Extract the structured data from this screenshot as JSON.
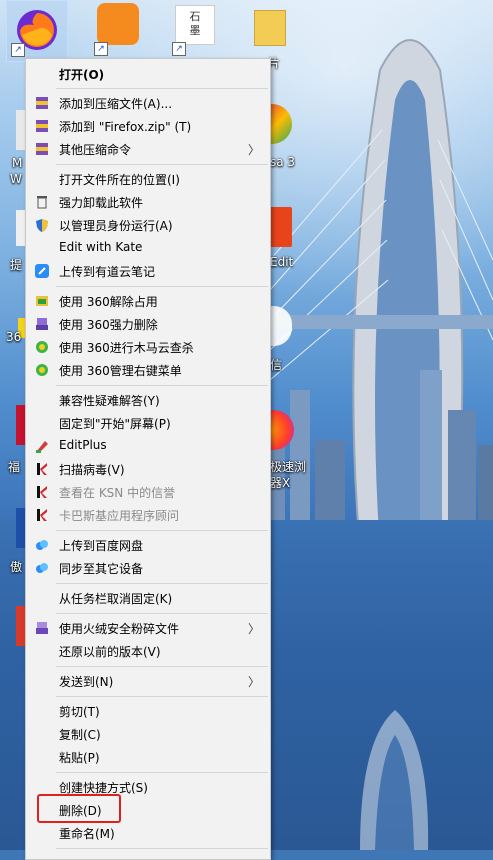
{
  "desktop": {
    "icons": [
      {
        "name": "Firefox",
        "label": ""
      },
      {
        "name": "UC Browser",
        "label": ""
      },
      {
        "name": "石墨",
        "label": "石\n墨"
      },
      {
        "name": "folder",
        "label": "片"
      }
    ],
    "edge_labels": {
      "left_m": "M",
      "left_w": "W",
      "left_ti": "提",
      "left_36": "36",
      "left_fu": "福",
      "left_ao": "傲",
      "right_sa3": "sa 3",
      "right_edit": "Edit",
      "right_xin": "信",
      "right_jisu1": "极速浏",
      "right_jisu2": "器X"
    }
  },
  "context_menu": {
    "items": [
      {
        "label": "打开(O)",
        "bold": true
      },
      {
        "label": "添加到压缩文件(A)..."
      },
      {
        "label": "添加到 \"Firefox.zip\" (T)"
      },
      {
        "label": "其他压缩命令",
        "submenu": true
      },
      {
        "label": "打开文件所在的位置(I)"
      },
      {
        "label": "强力卸载此软件"
      },
      {
        "label": "以管理员身份运行(A)"
      },
      {
        "label": "Edit with Kate"
      },
      {
        "label": "上传到有道云笔记"
      },
      {
        "label": "使用 360解除占用"
      },
      {
        "label": "使用 360强力删除"
      },
      {
        "label": "使用 360进行木马云查杀"
      },
      {
        "label": "使用 360管理右键菜单"
      },
      {
        "label": "兼容性疑难解答(Y)"
      },
      {
        "label": "固定到\"开始\"屏幕(P)"
      },
      {
        "label": "EditPlus"
      },
      {
        "label": "扫描病毒(V)"
      },
      {
        "label": "查看在 KSN 中的信誉",
        "disabled": true
      },
      {
        "label": "卡巴斯基应用程序顾问",
        "disabled": true
      },
      {
        "label": "上传到百度网盘"
      },
      {
        "label": "同步至其它设备"
      },
      {
        "label": "从任务栏取消固定(K)"
      },
      {
        "label": "使用火绒安全粉碎文件",
        "submenu": true
      },
      {
        "label": "还原以前的版本(V)"
      },
      {
        "label": "发送到(N)",
        "submenu": true
      },
      {
        "label": "剪切(T)"
      },
      {
        "label": "复制(C)"
      },
      {
        "label": "粘贴(P)"
      },
      {
        "label": "创建快捷方式(S)"
      },
      {
        "label": "删除(D)",
        "highlighted": true
      },
      {
        "label": "重命名(M)"
      }
    ],
    "submenu_arrow": "〉",
    "highlight_color": "#e02020"
  }
}
